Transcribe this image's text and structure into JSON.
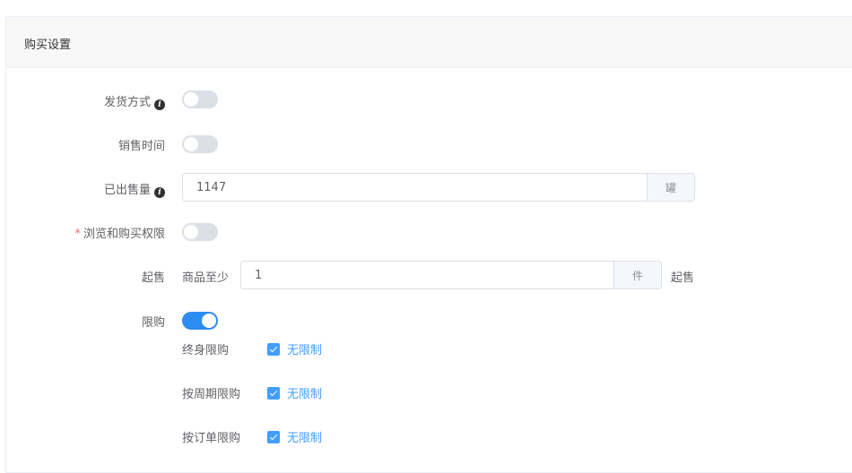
{
  "card": {
    "title": "购买设置"
  },
  "fields": {
    "shipping": {
      "label": "发货方式",
      "info_icon": "info-icon",
      "switch_on": false
    },
    "sale_time": {
      "label": "销售时间",
      "switch_on": false
    },
    "sold_count": {
      "label": "已出售量",
      "info_icon": "info-icon",
      "value": "1147",
      "unit": "罐"
    },
    "permission": {
      "label": "浏览和购买权限",
      "required_mark": "*",
      "switch_on": false
    },
    "min_purchase": {
      "label": "起售",
      "prefix": "商品至少",
      "value": "1",
      "unit": "件",
      "suffix": "起售"
    },
    "limit": {
      "label": "限购",
      "switch_on": true,
      "rows": [
        {
          "label": "终身限购",
          "checkbox_label": "无限制",
          "checked": true
        },
        {
          "label": "按周期限购",
          "checkbox_label": "无限制",
          "checked": true
        },
        {
          "label": "按订单限购",
          "checkbox_label": "无限制",
          "checked": true
        }
      ]
    }
  },
  "colors": {
    "accent": "#2d8cf0",
    "checkbox": "#409eff",
    "required": "#f56c6c"
  }
}
